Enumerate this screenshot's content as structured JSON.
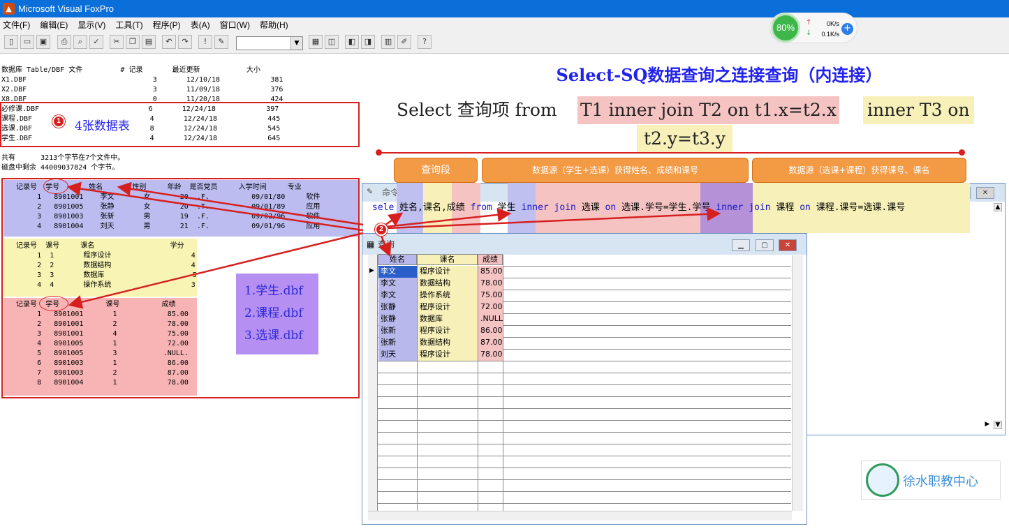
{
  "app": {
    "title": "Microsoft Visual FoxPro",
    "icon": "fox-icon"
  },
  "menu": [
    "文件(F)",
    "编辑(E)",
    "显示(V)",
    "工具(T)",
    "程序(P)",
    "表(A)",
    "窗口(W)",
    "帮助(H)"
  ],
  "network": {
    "percent": "80%",
    "up": "0K/s",
    "down": "0.1K/s"
  },
  "dir_listing": {
    "header": "数据库 Table/DBF 文件         # 记录       最近更新           大小",
    "rows": [
      "X1.DBF                              3       12/10/18            381",
      "X2.DBF                              3       11/09/18            376",
      "X8.DBF                              0       11/20/18            424",
      "必修课.DBF                          6       12/24/18            397",
      "课程.DBF                            4       12/24/18            445",
      "选课.DBF                            8       12/24/18            545",
      "学生.DBF                            4       12/24/18            645"
    ],
    "summary1": "共有      3213个字节在7个文件中。",
    "summary2": "磁盘中剩余 44009037824 个字节。"
  },
  "annot1": {
    "num": "1",
    "text": "4张数据表"
  },
  "student_table": {
    "header": "   记录号  学号       姓名       性别     年龄  是否党员     入学时间     专业",
    "rows": [
      "        1   8901001    李文       女       20  .F.          09/01/80     软件",
      "        2   8901005    张静       女       20  .T.          09/01/89     应用",
      "        3   8901003    张新       男       19  .F.          09/02/96     软件",
      "        4   8901004    刘天       男       21  .F.          09/01/96     应用"
    ]
  },
  "course_table": {
    "header": "   记录号  课号     课名                  学分",
    "rows": [
      "        1  1       程序设计                   4",
      "        2  2       数据结构                   4",
      "        3  3       数据库                     5",
      "        4  4       操作系统                   3"
    ]
  },
  "select_table": {
    "header": "   记录号  学号           课号          成绩",
    "rows": [
      "        1   8901001       1            85.00",
      "        2   8901001       2            78.00",
      "        3   8901001       4            75.00",
      "        4   8901005       1            72.00",
      "        5   8901005       3           .NULL.",
      "        6   8901003       1            86.00",
      "        7   8901003       2            87.00",
      "        8   8901004       1            78.00"
    ]
  },
  "dbf_list": [
    "1.学生.dbf",
    "2.课程.dbf",
    "3.选课.dbf"
  ],
  "title": "Select-SQ数据查询之连接查询（内连接）",
  "syntax": {
    "p1": "Select  查询项   from ",
    "p2": "T1 inner join T2 on t1.x=t2.x",
    "p3": " inner T3 on",
    "p4": "t2.y=t3.y"
  },
  "labels": {
    "query": "查询段",
    "src1": "数据源（学生+选课）获得姓名、成绩和课号",
    "src2": "数据源（选课+课程）获得课号、课名"
  },
  "cmd_window": {
    "title": "命令",
    "sele": "sele ",
    "f1": "姓名,",
    "f2": "课名,",
    "f3": "成绩 ",
    "from": "from ",
    "t1": "学生 ",
    "ij1": "inner join ",
    "t2": "选课 ",
    "on1": "on ",
    "c1a": "选课.学号=",
    "c1b": "学生.学号 ",
    "ij2": "inner join ",
    "t3": "课程 ",
    "on2": "on ",
    "c2": "课程.课号=选课.课号"
  },
  "annot2": {
    "num": "2"
  },
  "query_window": {
    "title": "查询",
    "columns": [
      "姓名",
      "课名",
      "成绩"
    ],
    "rows": [
      [
        "李文",
        "程序设计",
        "85.00"
      ],
      [
        "李文",
        "数据结构",
        "78.00"
      ],
      [
        "李文",
        "操作系统",
        "75.00"
      ],
      [
        "张静",
        "程序设计",
        "72.00"
      ],
      [
        "张静",
        "数据库",
        ".NULL."
      ],
      [
        "张新",
        "程序设计",
        "86.00"
      ],
      [
        "张新",
        "数据结构",
        "87.00"
      ],
      [
        "刘天",
        "程序设计",
        "78.00"
      ]
    ]
  },
  "logo": {
    "text": "徐水职教中心"
  }
}
